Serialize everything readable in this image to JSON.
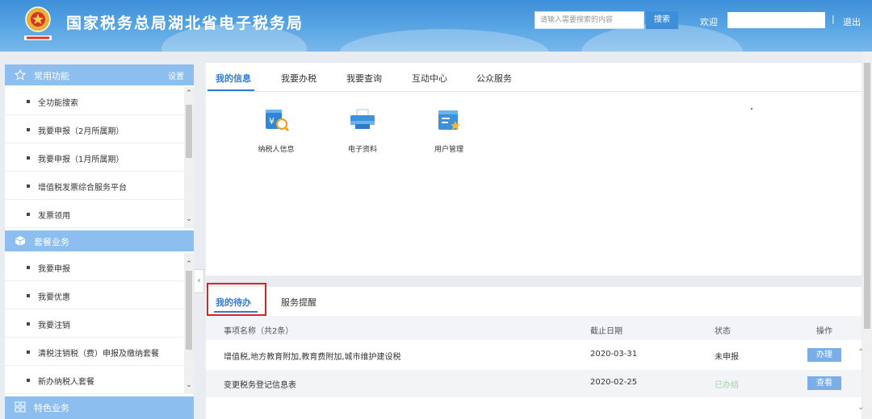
{
  "header": {
    "title": "国家税务总局湖北省电子税务局",
    "search_placeholder": "请输入需要搜索的内容",
    "search_label": "搜索",
    "welcome": "欢迎",
    "separator": "|",
    "logout": "退出"
  },
  "sidebar": {
    "section1": {
      "title": "常用功能",
      "settings": "设置",
      "icon": "star-icon",
      "items": [
        "全功能搜索",
        "我要申报（2月所属期）",
        "我要申报（1月所属期）",
        "增值税发票综合服务平台",
        "发票领用"
      ]
    },
    "section2": {
      "title": "套餐业务",
      "icon": "cube-icon",
      "items": [
        "我要申报",
        "我要优惠",
        "我要注销",
        "清税注销税（费）申报及缴纳套餐",
        "新办纳税人套餐"
      ]
    },
    "section3": {
      "title": "特色业务",
      "icon": "grid-icon"
    }
  },
  "main": {
    "tabs": [
      "我的信息",
      "我要办税",
      "我要查询",
      "互动中心",
      "公众服务"
    ],
    "apps": [
      {
        "label": "纳税人信息",
        "icon": "taxpayer-info-icon"
      },
      {
        "label": "电子资料",
        "icon": "printer-icon"
      },
      {
        "label": "用户管理",
        "icon": "user-management-icon"
      }
    ]
  },
  "todo": {
    "tabs": [
      "我的待办",
      "服务提醒"
    ],
    "headers": [
      "事项名称（共2条）",
      "截止日期",
      "状态",
      "操作"
    ],
    "rows": [
      {
        "name": "增值税,地方教育附加,教育费附加,城市维护建设税",
        "date": "2020-03-31",
        "status": "未申报",
        "action": "办理"
      },
      {
        "name": "变更税务登记信息表",
        "date": "2020-02-25",
        "status": "已办结",
        "action": "查看"
      }
    ]
  },
  "colors": {
    "header_blue": "#4a9ade",
    "section_blue": "#8cbef0",
    "accent": "#2f7bd6",
    "highlight_red": "#d9251c"
  }
}
